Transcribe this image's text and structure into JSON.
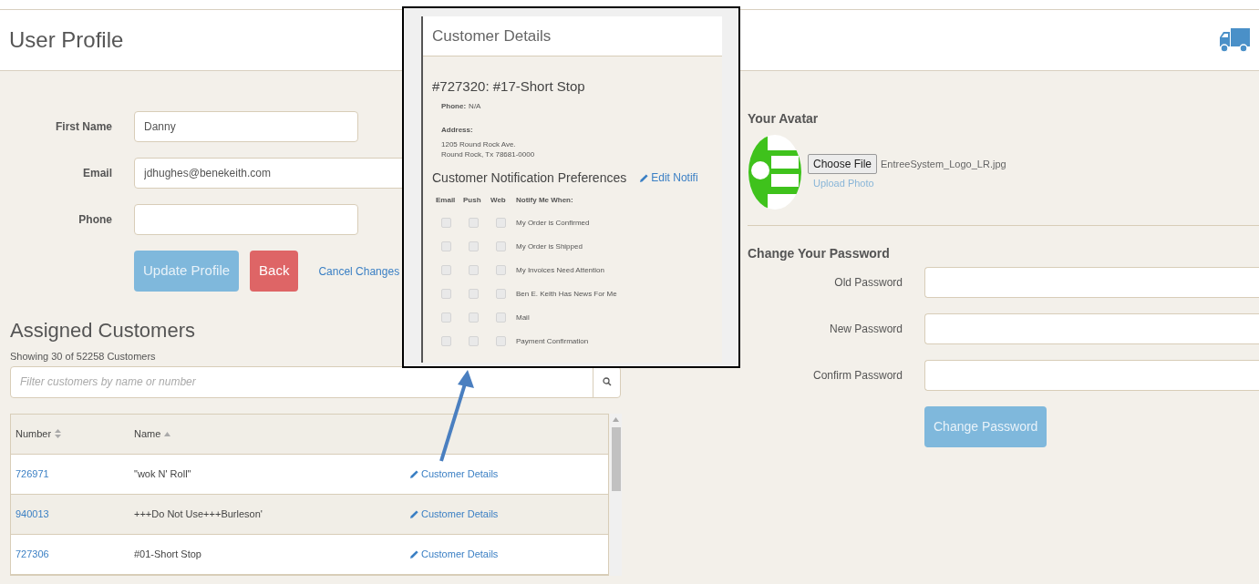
{
  "header": {
    "title": "User Profile"
  },
  "profile_form": {
    "fields": [
      {
        "label": "First Name",
        "value": "Danny"
      },
      {
        "label": "Email",
        "value": "jdhughes@benekeith.com"
      },
      {
        "label": "Phone"
      }
    ],
    "buttons": [
      {
        "label": "Update Profile",
        "kind": "primary"
      },
      {
        "label": "Back",
        "kind": "danger"
      },
      {
        "label": "Cancel Changes",
        "kind": "link"
      }
    ]
  },
  "assigned_customers": {
    "title": "Assigned Customers",
    "count": "Showing 30 of 52258 Customers",
    "search": {
      "placeholder": "Filter customers by name or number"
    },
    "columns": [
      {
        "label": "Number",
        "kind": "sortable"
      },
      {
        "label": "Name",
        "kind": "ascending"
      }
    ],
    "rows": [
      {
        "number": "726971",
        "name": "\"wok N' Roll\"",
        "action": "Customer Details"
      },
      {
        "number": "940013",
        "name": "+++Do Not Use+++Burleson'",
        "action": "Customer Details"
      },
      {
        "number": "727306",
        "name": "#01-Short Stop",
        "action": "Customer Details"
      }
    ]
  },
  "avatar": {
    "title": "Your Avatar",
    "choose_button": "Choose File",
    "file_name": "EntreeSystem_Logo_LR.jpg",
    "upload_link": "Upload Photo"
  },
  "password": {
    "title": "Change Your Password",
    "fields": [
      {
        "label": "Old Password"
      },
      {
        "label": "New Password"
      },
      {
        "label": "Confirm Password"
      }
    ],
    "button": "Change Password"
  },
  "customer_details_popup": {
    "title": "Customer Details",
    "customer": "#727320: #17-Short Stop",
    "phone_label": "Phone:",
    "phone": "N/A",
    "address_label": "Address:",
    "address_lines": [
      "1205 Round Rock Ave.",
      "Round Rock, Tx 78681-0000"
    ],
    "preferences_title": "Customer Notification Preferences",
    "edit_link": "Edit Notifi",
    "columns": [
      "Email",
      "Push",
      "Web",
      "Notify Me When:"
    ],
    "preferences": [
      {
        "label": "My Order is Confirmed",
        "email": false,
        "push": false,
        "web": false
      },
      {
        "label": "My Order is Shipped",
        "email": false,
        "push": false,
        "web": false
      },
      {
        "label": "My Invoices Need Attention",
        "email": false,
        "push": false,
        "web": false
      },
      {
        "label": "Ben E. Keith Has News For Me",
        "email": false,
        "push": false,
        "web": false
      },
      {
        "label": "Mail",
        "email": false,
        "push": false,
        "web": false
      },
      {
        "label": "Payment Confirmation",
        "email": false,
        "push": false,
        "web": false
      }
    ]
  }
}
